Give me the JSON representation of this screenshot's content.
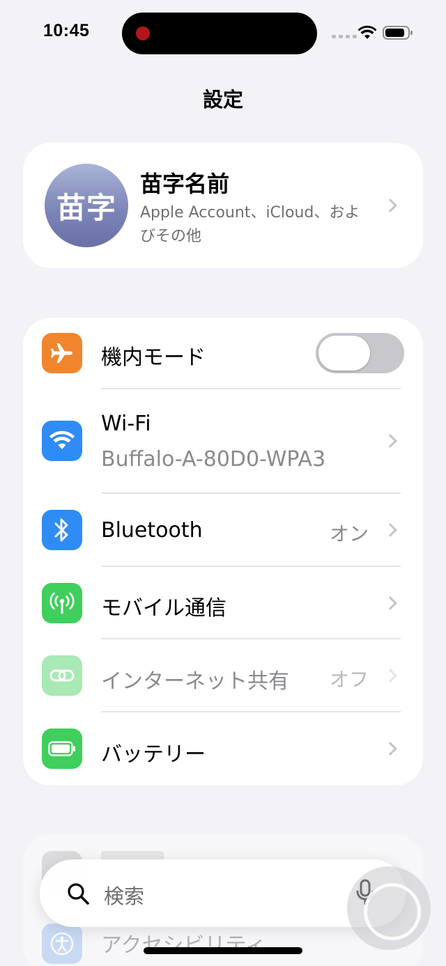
{
  "status_bar": {
    "time": "10:45"
  },
  "nav": {
    "title": "設定"
  },
  "account": {
    "avatar_initials": "苗字",
    "name": "苗字名前",
    "subtitle": "Apple Account、iCloud、およびその他"
  },
  "settings": {
    "airplane": {
      "label": "機内モード",
      "toggle_on": false,
      "icon": "airplane-icon",
      "color": "#f0852d"
    },
    "wifi": {
      "label": "Wi-Fi",
      "network": "Buffalo-A-80D0-WPA3",
      "icon": "wifi-icon",
      "color": "#2f8cf5"
    },
    "bluetooth": {
      "label": "Bluetooth",
      "value": "オン",
      "icon": "bluetooth-icon",
      "color": "#2f8cf5"
    },
    "cellular": {
      "label": "モバイル通信",
      "icon": "antenna-icon",
      "color": "#3fcf5c"
    },
    "hotspot": {
      "label": "インターネット共有",
      "value": "オフ",
      "icon": "link-icon",
      "color": "#3fcf5c",
      "disabled": true
    },
    "battery": {
      "label": "バッテリー",
      "icon": "battery-icon",
      "color": "#3fcf5c"
    }
  },
  "next_group": {
    "accessibility_label": "アクセシビリティ"
  },
  "search": {
    "placeholder": "検索"
  }
}
